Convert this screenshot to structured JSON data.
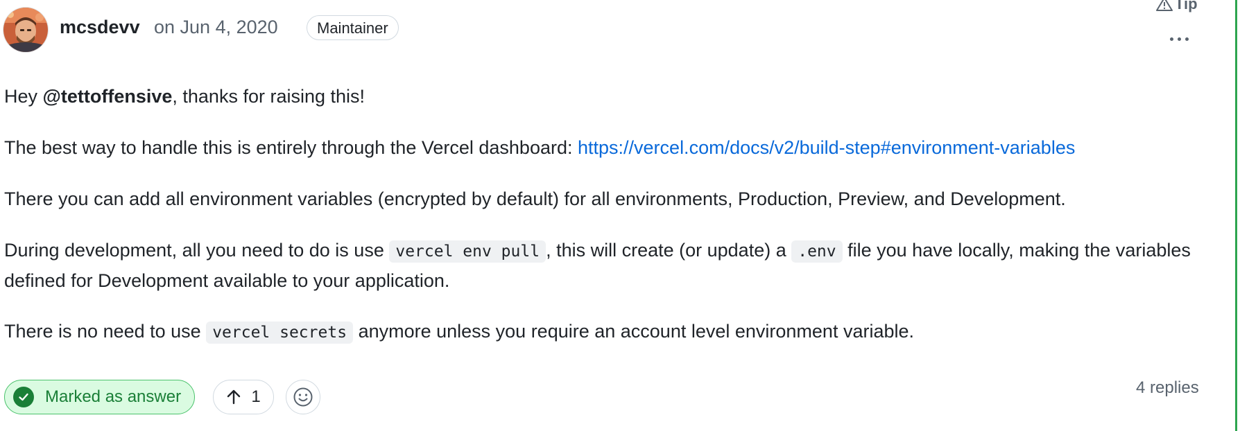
{
  "comment": {
    "author": "mcsdevv",
    "date": "on Jun 4, 2020",
    "role": "Maintainer",
    "tip_label": "Tip"
  },
  "body": {
    "p1_prefix": "Hey ",
    "p1_mention": "@tettoffensive",
    "p1_suffix": ", thanks for raising this!",
    "p2_text": "The best way to handle this is entirely through the Vercel dashboard: ",
    "p2_link": "https://vercel.com/docs/v2/build-step#environment-variables",
    "p3_text": "There you can add all environment variables (encrypted by default) for all environments, Production, Preview, and Development.",
    "p4_prefix": "During development, all you need to do is use ",
    "p4_code1": "vercel env pull",
    "p4_mid": ", this will create (or update) a ",
    "p4_code2": ".env",
    "p4_suffix": " file you have locally, making the variables defined for Development available to your application.",
    "p5_prefix": "There is no need to use ",
    "p5_code": "vercel secrets",
    "p5_suffix": " anymore unless you require an account level environment variable."
  },
  "footer": {
    "answer_label": "Marked as answer",
    "upvote_count": "1",
    "replies": "4 replies"
  },
  "colors": {
    "link": "#0969da",
    "answer_green": "#1a7f37",
    "answer_bg": "#dafbe1",
    "rail": "#2da44e"
  },
  "icons": [
    "avatar",
    "tip-alert-icon",
    "kebab-menu-icon",
    "check-circle-icon",
    "arrow-up-icon",
    "smiley-icon"
  ]
}
